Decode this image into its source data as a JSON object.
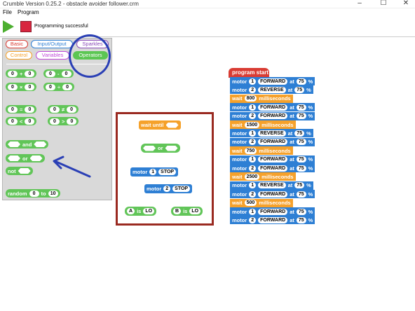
{
  "window": {
    "title": "Crumble Version 0.25.2 - obstacle avoider follower.crm",
    "controls": [
      "–",
      "☐",
      "✕"
    ]
  },
  "menu": [
    "File",
    "Program"
  ],
  "toolbar": {
    "status": "Programming successful",
    "play_icon": "play-icon",
    "stop_icon": "stop-icon",
    "colors": {
      "play": "#4caf2f",
      "stop": "#d8263f"
    }
  },
  "palette": {
    "categories": [
      {
        "label": "Basic",
        "color": "#d93c33"
      },
      {
        "label": "Input/Output",
        "color": "#2e7fd4"
      },
      {
        "label": "Sparkles",
        "color": "#8a4ab8"
      },
      {
        "label": "Control",
        "color": "#f5a12b"
      },
      {
        "label": "Variables",
        "color": "#c04bd8"
      },
      {
        "label": "Operators",
        "color": "#5cc653",
        "active": true
      }
    ],
    "ops": [
      {
        "left": "0",
        "op": "+",
        "right": "0"
      },
      {
        "left": "0",
        "op": "-",
        "right": "0"
      },
      {
        "left": "0",
        "op": "×",
        "right": "0"
      },
      {
        "left": "0",
        "op": "÷",
        "right": "0"
      },
      {
        "left": "0",
        "op": "=",
        "right": "0"
      },
      {
        "left": "0",
        "op": "≠",
        "right": "0"
      },
      {
        "left": "0",
        "op": "<",
        "right": "0"
      },
      {
        "left": "0",
        "op": ">",
        "right": "0"
      }
    ],
    "logic": {
      "and": "and",
      "or": "or",
      "not": "not"
    },
    "random": {
      "label": "random",
      "from": "0",
      "to_label": "to",
      "to": "10"
    }
  },
  "redbox": {
    "wait_until": "wait until",
    "or": "or",
    "motor1": {
      "label": "motor",
      "num": "1",
      "action": "STOP"
    },
    "motor2": {
      "label": "motor",
      "num": "2",
      "action": "STOP"
    },
    "a_is": {
      "var": "A",
      "is": "is",
      "val": "LO"
    },
    "b_is": {
      "var": "B",
      "is": "is",
      "val": "LO"
    }
  },
  "script": {
    "start": "program start",
    "rows": [
      {
        "type": "motor",
        "num": "1",
        "dir": "FORWARD",
        "at": "at",
        "speed": "75",
        "pct": "%"
      },
      {
        "type": "motor",
        "num": "2",
        "dir": "REVERSE",
        "at": "at",
        "speed": "75",
        "pct": "%"
      },
      {
        "type": "wait",
        "value": "800",
        "unit": "milliseconds"
      },
      {
        "type": "motor",
        "num": "1",
        "dir": "FORWARD",
        "at": "at",
        "speed": "75",
        "pct": "%"
      },
      {
        "type": "motor",
        "num": "2",
        "dir": "FORWARD",
        "at": "at",
        "speed": "75",
        "pct": "%"
      },
      {
        "type": "wait",
        "value": "1500",
        "unit": "milliseconds"
      },
      {
        "type": "motor",
        "num": "1",
        "dir": "REVERSE",
        "at": "at",
        "speed": "75",
        "pct": "%"
      },
      {
        "type": "motor",
        "num": "2",
        "dir": "FORWARD",
        "at": "at",
        "speed": "75",
        "pct": "%"
      },
      {
        "type": "wait",
        "value": "750",
        "unit": "milliseconds"
      },
      {
        "type": "motor",
        "num": "1",
        "dir": "FORWARD",
        "at": "at",
        "speed": "75",
        "pct": "%"
      },
      {
        "type": "motor",
        "num": "2",
        "dir": "FORWARD",
        "at": "at",
        "speed": "75",
        "pct": "%"
      },
      {
        "type": "wait",
        "value": "2500",
        "unit": "milliseconds"
      },
      {
        "type": "motor",
        "num": "1",
        "dir": "REVERSE",
        "at": "at",
        "speed": "75",
        "pct": "%"
      },
      {
        "type": "motor",
        "num": "2",
        "dir": "FORWARD",
        "at": "at",
        "speed": "75",
        "pct": "%"
      },
      {
        "type": "wait",
        "value": "500",
        "unit": "milliseconds"
      },
      {
        "type": "motor",
        "num": "1",
        "dir": "FORWARD",
        "at": "at",
        "speed": "75",
        "pct": "%"
      },
      {
        "type": "motor",
        "num": "2",
        "dir": "FORWARD",
        "at": "at",
        "speed": "75",
        "pct": "%"
      }
    ]
  }
}
